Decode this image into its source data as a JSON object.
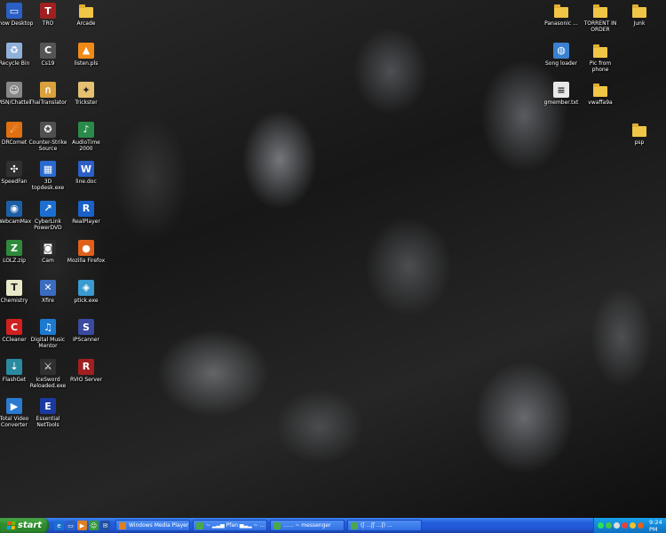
{
  "desktop": {
    "icons_left": [
      {
        "label": "Show Desktop",
        "icon": "show-desktop-icon",
        "color": "#2b5fc6",
        "glyph": "▭"
      },
      {
        "label": "TRO",
        "icon": "tro-game-icon",
        "color": "#a02020",
        "glyph": "T"
      },
      {
        "label": "Arcade",
        "icon": "folder-icon",
        "color": "#f1c546",
        "glyph": ""
      },
      {
        "label": "Recycle Bin",
        "icon": "recycle-bin-icon",
        "color": "#8fb1d9",
        "glyph": "♻"
      },
      {
        "label": "Cs19",
        "icon": "cs-game-icon",
        "color": "#555555",
        "glyph": "C"
      },
      {
        "label": "listen.pls",
        "icon": "vlc-icon",
        "color": "#f08a16",
        "glyph": "▲"
      },
      {
        "label": "MSN/Chatter",
        "icon": "msn-icon",
        "color": "#888888",
        "glyph": "☺"
      },
      {
        "label": "ThaiTranslator",
        "icon": "translator-icon",
        "color": "#d9a03c",
        "glyph": "ก"
      },
      {
        "label": "Trickster",
        "icon": "trickster-icon",
        "color": "#e4c070",
        "glyph": "✦"
      },
      {
        "label": "DRComet",
        "icon": "drcomet-icon",
        "color": "#e07010",
        "glyph": "☄"
      },
      {
        "label": "Counter-Strike Source",
        "icon": "counter-strike-icon",
        "color": "#505050",
        "glyph": "✪"
      },
      {
        "label": "AudioTime 2000",
        "icon": "audiotime-icon",
        "color": "#2a8a4a",
        "glyph": "♪"
      },
      {
        "label": "SpeedFan",
        "icon": "speedfan-icon",
        "color": "#303030",
        "glyph": "✣"
      },
      {
        "label": "3D topdesk.exe",
        "icon": "3d-topdesk-icon",
        "color": "#2a6ad0",
        "glyph": "▦"
      },
      {
        "label": "line.doc",
        "icon": "word-doc-icon",
        "color": "#2b5fc6",
        "glyph": "W"
      },
      {
        "label": "WebcamMax",
        "icon": "webcammax-icon",
        "color": "#1c5fa6",
        "glyph": "◉"
      },
      {
        "label": "CyberLink PowerDVD",
        "icon": "cyberlink-icon",
        "color": "#1c6fd0",
        "glyph": "↗"
      },
      {
        "label": "RealPlayer",
        "icon": "realplayer-icon",
        "color": "#1a60c8",
        "glyph": "R"
      },
      {
        "label": "LOLZ.zip",
        "icon": "zip-file-icon",
        "color": "#2e8a3a",
        "glyph": "Z"
      },
      {
        "label": "Cam",
        "icon": "cam-icon",
        "color": "#2b2b2b",
        "glyph": "◙"
      },
      {
        "label": "Mozilla Firefox",
        "icon": "firefox-icon",
        "color": "#e0601a",
        "glyph": "●"
      },
      {
        "label": "Chemistry",
        "icon": "chemistry-icon",
        "color": "#e8e8c8",
        "glyph": "T"
      },
      {
        "label": "Xfire",
        "icon": "xfire-icon",
        "color": "#3a6cc0",
        "glyph": "✕"
      },
      {
        "label": "ptick.exe",
        "icon": "ptick-icon",
        "color": "#3a9ad0",
        "glyph": "◈"
      },
      {
        "label": "CCleaner",
        "icon": "ccleaner-icon",
        "color": "#d02020",
        "glyph": "C"
      },
      {
        "label": "Digital Music Mentor",
        "icon": "music-mentor-icon",
        "color": "#1c7ad0",
        "glyph": "♫"
      },
      {
        "label": "IPScanner",
        "icon": "ipscanner-icon",
        "color": "#3a4aa0",
        "glyph": "S"
      },
      {
        "label": "FlashGet",
        "icon": "flashget-icon",
        "color": "#2a8aa0",
        "glyph": "⇣"
      },
      {
        "label": "IceSword Reloaded.exe",
        "icon": "icesword-icon",
        "color": "#303030",
        "glyph": "⚔"
      },
      {
        "label": "RVIO Server",
        "icon": "rvio-server-icon",
        "color": "#a02020",
        "glyph": "R"
      },
      {
        "label": "Total Video Converter",
        "icon": "video-converter-icon",
        "color": "#2a7ad0",
        "glyph": "▶"
      },
      {
        "label": "Essential NetTools",
        "icon": "nettools-icon",
        "color": "#1a3aa0",
        "glyph": "E"
      }
    ],
    "icons_right": [
      {
        "label": "Panasonic ...",
        "icon": "folder-icon",
        "color": "#f1c546",
        "glyph": ""
      },
      {
        "label": "TORRENT IN ORDER",
        "icon": "folder-icon",
        "color": "#f1c546",
        "glyph": ""
      },
      {
        "label": "Junk",
        "icon": "folder-icon",
        "color": "#f1c546",
        "glyph": ""
      },
      {
        "label": "Song loader",
        "icon": "song-loader-icon",
        "color": "#3a80d0",
        "glyph": "◍"
      },
      {
        "label": "Pic from phone",
        "icon": "folder-icon",
        "color": "#f1c546",
        "glyph": ""
      },
      {
        "label": "gmember.txt",
        "icon": "text-file-icon",
        "color": "#e8e8e8",
        "glyph": "≡"
      },
      {
        "label": "vwaffa9a",
        "icon": "folder-icon",
        "color": "#f1c546",
        "glyph": ""
      },
      {
        "label": "psp",
        "icon": "folder-icon",
        "color": "#f1c546",
        "glyph": ""
      }
    ]
  },
  "taskbar": {
    "start_label": "start",
    "quick_launch": [
      {
        "icon": "ie-icon",
        "color": "#1a70d0",
        "glyph": "e"
      },
      {
        "icon": "show-desktop-quick-icon",
        "color": "#2a5fc6",
        "glyph": "▭"
      },
      {
        "icon": "media-player-quick-icon",
        "color": "#e08020",
        "glyph": "▶"
      },
      {
        "icon": "msn-quick-icon",
        "color": "#3a9a3a",
        "glyph": "☺"
      },
      {
        "icon": "outlook-quick-icon",
        "color": "#2050a0",
        "glyph": "✉"
      }
    ],
    "tasks": [
      {
        "label": "Windows Media Player",
        "icon": "media-player-icon",
        "color": "#e08020"
      },
      {
        "label": "~ ▂▃▅ Pfan ▅▃▂ ~ ...",
        "icon": "msn-chat-icon",
        "color": "#4aa84a"
      },
      {
        "label": "...... ~ messenger",
        "icon": "msn-chat-icon",
        "color": "#4aa84a"
      },
      {
        "label": "(ʃ ...ʃʃ ...ʃ) ...",
        "icon": "msn-chat-icon",
        "color": "#4aa84a"
      }
    ],
    "tray": {
      "clock": "9:24 PM",
      "icons": [
        {
          "icon": "network-tray-icon",
          "color": "#2ae060"
        },
        {
          "icon": "msn-tray-icon",
          "color": "#44c844"
        },
        {
          "icon": "volume-tray-icon",
          "color": "#dddddd"
        },
        {
          "icon": "antivirus-tray-icon",
          "color": "#e84040"
        },
        {
          "icon": "update-tray-icon",
          "color": "#f0c030"
        },
        {
          "icon": "xfire-tray-icon",
          "color": "#e06020"
        }
      ]
    }
  }
}
